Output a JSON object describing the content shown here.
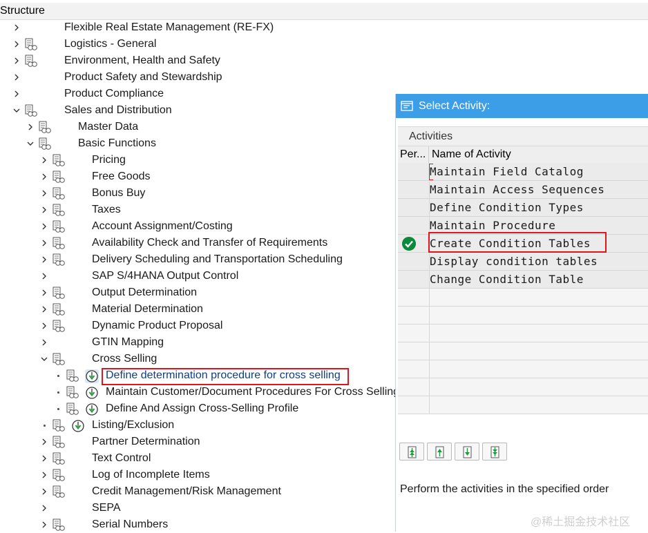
{
  "tree": {
    "header": "Structure",
    "rows": [
      {
        "label": "Flexible Real Estate Management (RE-FX)"
      },
      {
        "label": "Logistics - General"
      },
      {
        "label": "Environment, Health and Safety"
      },
      {
        "label": "Product Safety and Stewardship"
      },
      {
        "label": "Product Compliance"
      },
      {
        "label": "Sales and Distribution"
      },
      {
        "label": "Master Data"
      },
      {
        "label": "Basic Functions"
      },
      {
        "label": "Pricing"
      },
      {
        "label": "Free Goods"
      },
      {
        "label": "Bonus Buy"
      },
      {
        "label": "Taxes"
      },
      {
        "label": "Account Assignment/Costing"
      },
      {
        "label": "Availability Check and Transfer of Requirements"
      },
      {
        "label": "Delivery Scheduling and Transportation Scheduling"
      },
      {
        "label": "SAP S/4HANA Output Control"
      },
      {
        "label": "Output Determination"
      },
      {
        "label": "Material Determination"
      },
      {
        "label": "Dynamic Product Proposal"
      },
      {
        "label": "GTIN Mapping"
      },
      {
        "label": "Cross Selling"
      },
      {
        "label": "Define determination procedure for cross selling"
      },
      {
        "label": "Maintain Customer/Document Procedures For Cross Selling"
      },
      {
        "label": "Define And Assign Cross-Selling Profile"
      },
      {
        "label": "Listing/Exclusion"
      },
      {
        "label": "Partner Determination"
      },
      {
        "label": "Text Control"
      },
      {
        "label": "Log of Incomplete Items"
      },
      {
        "label": "Credit Management/Risk Management"
      },
      {
        "label": "SEPA"
      },
      {
        "label": "Serial Numbers"
      }
    ]
  },
  "popup": {
    "title": "Select Activity:",
    "section_caption": "Activities",
    "col_performed": "Per...",
    "col_name": "Name of Activity",
    "activities": [
      {
        "name": "Maintain Field Catalog",
        "done": false
      },
      {
        "name": "Maintain Access Sequences",
        "done": false
      },
      {
        "name": "Define Condition Types",
        "done": false
      },
      {
        "name": "Maintain Procedure",
        "done": false
      },
      {
        "name": "Create Condition Tables",
        "done": true
      },
      {
        "name": "Display condition tables",
        "done": false
      },
      {
        "name": "Change Condition Table",
        "done": false
      }
    ],
    "hint": "Perform the activities in the specified order"
  },
  "watermark": "@稀土掘金技术社区",
  "colors": {
    "title_bar": "#3d9ee8",
    "highlight": "#e0141e",
    "check_green": "#0c8a3c"
  }
}
